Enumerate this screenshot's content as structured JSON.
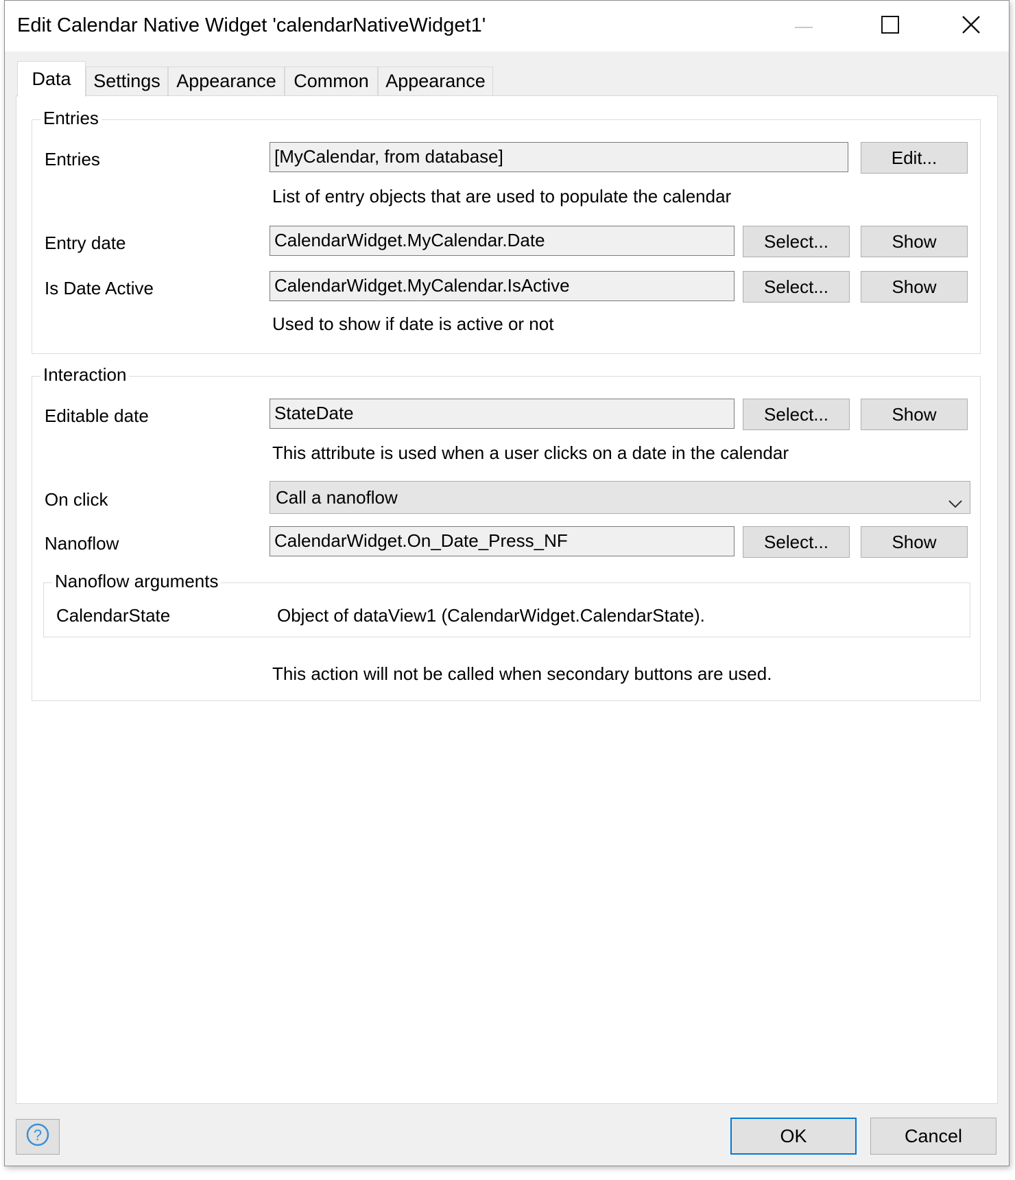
{
  "window": {
    "title": "Edit Calendar Native Widget 'calendarNativeWidget1'"
  },
  "tabs": [
    {
      "label": "Data",
      "active": true
    },
    {
      "label": "Settings"
    },
    {
      "label": "Appearance"
    },
    {
      "label": "Common"
    },
    {
      "label": "Appearance"
    }
  ],
  "entries_group": {
    "legend": "Entries",
    "entries": {
      "label": "Entries",
      "value": "[MyCalendar, from database]",
      "edit_button": "Edit...",
      "help": "List of entry objects that are used to populate the calendar"
    },
    "entry_date": {
      "label": "Entry date",
      "value": "CalendarWidget.MyCalendar.Date",
      "select_button": "Select...",
      "show_button": "Show"
    },
    "is_date_active": {
      "label": "Is Date Active",
      "value": "CalendarWidget.MyCalendar.IsActive",
      "select_button": "Select...",
      "show_button": "Show",
      "help": "Used to show if date is active or not"
    }
  },
  "interaction_group": {
    "legend": "Interaction",
    "editable_date": {
      "label": "Editable date",
      "value": "StateDate",
      "select_button": "Select...",
      "show_button": "Show",
      "help": "This attribute is used when a user clicks on a date in the calendar"
    },
    "on_click": {
      "label": "On click",
      "value": "Call a nanoflow"
    },
    "nanoflow": {
      "label": "Nanoflow",
      "value": "CalendarWidget.On_Date_Press_NF",
      "select_button": "Select...",
      "show_button": "Show"
    },
    "nanoflow_arguments": {
      "legend": "Nanoflow arguments",
      "argument_name": "CalendarState",
      "argument_value": "Object of dataView1 (CalendarWidget.CalendarState)."
    },
    "note": "This action will not be called when secondary buttons are used."
  },
  "footer": {
    "ok_label": "OK",
    "cancel_label": "Cancel"
  },
  "colors": {
    "accent": "#0078d7",
    "help_icon": "#3c8fd6"
  },
  "icons": {
    "minimize": "minimize-icon",
    "maximize": "maximize-icon",
    "close": "close-icon",
    "dropdown": "chevron-down-icon",
    "help": "question-circle-icon"
  }
}
